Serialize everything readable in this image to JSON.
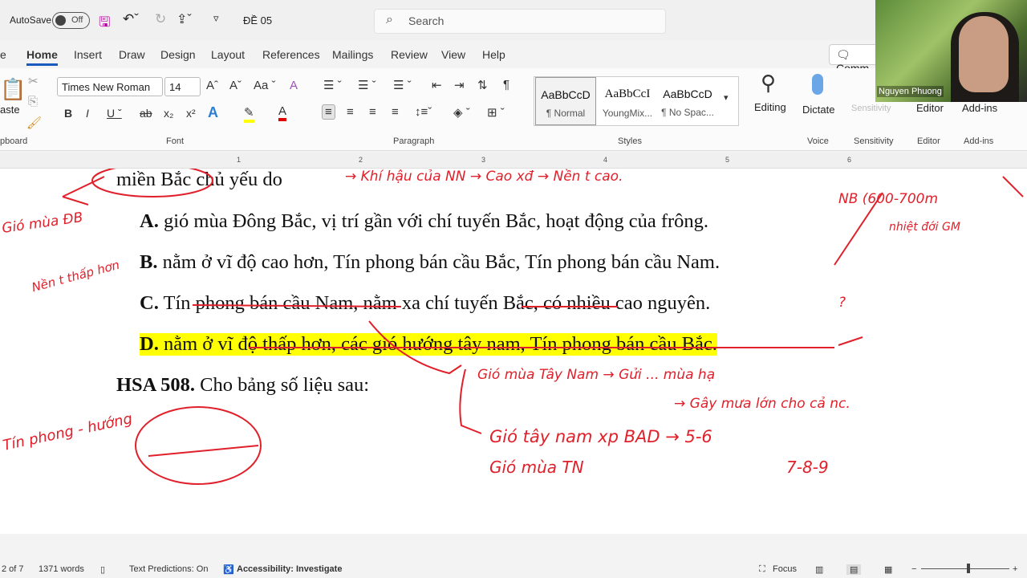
{
  "titlebar": {
    "autosave": "AutoSave",
    "toggle": "Off",
    "doc_name": "ĐỀ 05",
    "search_placeholder": "Search"
  },
  "tabs": [
    "e",
    "Home",
    "Insert",
    "Draw",
    "Design",
    "Layout",
    "References",
    "Mailings",
    "Review",
    "View",
    "Help"
  ],
  "comments": "Comm",
  "ribbon": {
    "paste": "aste",
    "font_name": "Times New Roman",
    "font_size": "14",
    "groups": {
      "clipboard": "pboard",
      "font": "Font",
      "paragraph": "Paragraph",
      "styles": "Styles",
      "voice": "Voice",
      "sensitivity": "Sensitivity",
      "editor": "Editor",
      "addins": "Add-ins"
    },
    "styles": [
      {
        "preview": "AaBbCcD",
        "name": "¶ Normal"
      },
      {
        "preview": "AaBbCcI",
        "name": "YoungMix..."
      },
      {
        "preview": "AaBbCcD",
        "name": "¶ No Spac..."
      }
    ],
    "editing": "Editing",
    "dictate": "Dictate",
    "sensitivity": "Sensitivity",
    "editor": "Editor",
    "addins": "Add-ins"
  },
  "video": {
    "name": "Nguyen Phuong"
  },
  "ruler": [
    "1",
    "2",
    "3",
    "4",
    "5",
    "6"
  ],
  "doc": {
    "line0": "miền Bắc chủ yếu do",
    "optA_letter": "A.",
    "optA": "gió mùa Đông Bắc, vị trí gần với chí tuyến Bắc, hoạt động của frông.",
    "optB_letter": "B.",
    "optB": "nằm ở vĩ độ cao hơn, Tín phong bán cầu Bắc, Tín phong bán cầu Nam.",
    "optC_letter": "C.",
    "optC": "Tín phong bán cầu Nam, nằm xa chí tuyến Bắc, có nhiều cao nguyên.",
    "optD_letter": "D.",
    "optD": "nằm ở vĩ độ thấp hơn, các gió hướng tây nam, Tín phong bán cầu Bắc.",
    "q_num": "HSA 508.",
    "q_text": "Cho bảng số liệu sau:"
  },
  "handwriting": {
    "h1": "→ Khí hậu của NN → Cao xđ → Nền t cao.",
    "h2": "NB (600-700m",
    "h3": "nhiệt đới GM",
    "h4": "Gió mùa ĐB",
    "h5": "Nền t thấp hơn",
    "h6": "Gió mùa Tây Nam → Gửi ... mùa hạ",
    "h7": "→ Gây mưa lớn cho cả nc.",
    "h8": "Gió tây nam xp BAD → 5-6",
    "h9": "Gió mùa TN",
    "h10": "7-8-9",
    "h11": "Tín phong - hướng",
    "h12": "?"
  },
  "status": {
    "page": "2 of 7",
    "words": "1371 words",
    "predictions": "Text Predictions: On",
    "accessibility": "Accessibility: Investigate",
    "focus": "Focus"
  }
}
